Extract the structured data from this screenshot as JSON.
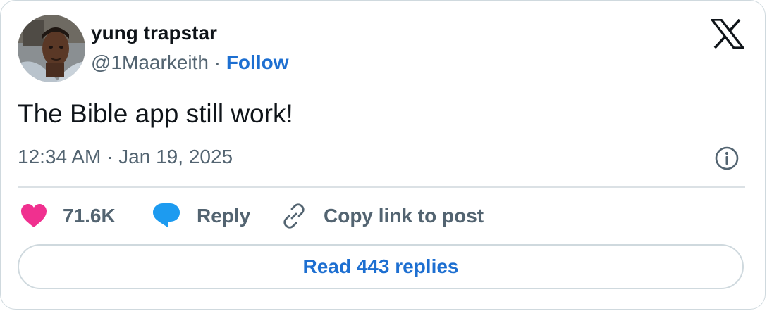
{
  "author": {
    "name": "yung trapstar",
    "handle": "@1Maarkeith",
    "separator": "·",
    "follow_label": "Follow",
    "avatar_icon": "profile-photo"
  },
  "brand": {
    "logo_icon": "x-logo-icon"
  },
  "tweet": {
    "text": "The Bible app still work!",
    "timestamp": "12:34 AM · Jan 19, 2025"
  },
  "actions": {
    "like_count": "71.6K",
    "reply_label": "Reply",
    "copy_link_label": "Copy link to post"
  },
  "footer": {
    "read_replies_label": "Read 443 replies"
  },
  "colors": {
    "text": "#0f1419",
    "secondary": "#536471",
    "link": "#1d6fd1",
    "like": "#f0308f",
    "reply": "#1d9bf0",
    "border": "#cfd9de"
  }
}
